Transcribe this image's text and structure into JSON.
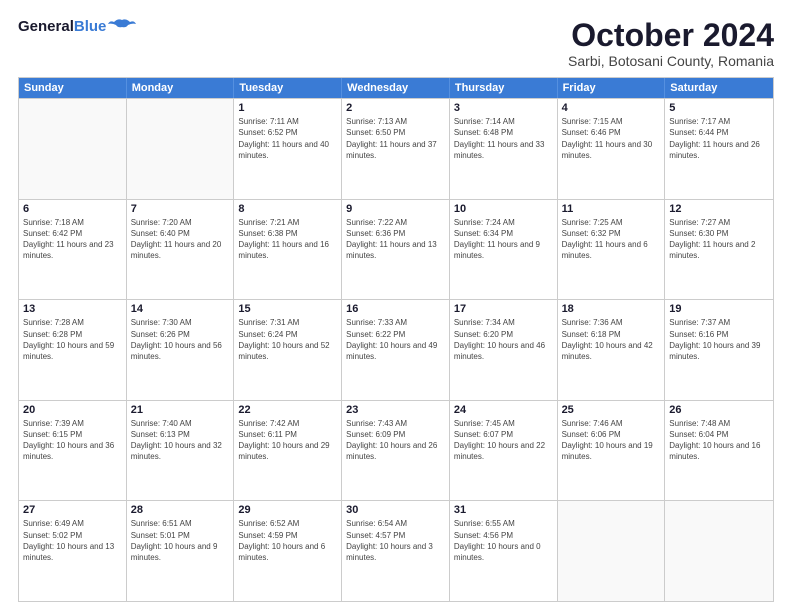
{
  "logo": {
    "line1": "General",
    "line2": "Blue"
  },
  "title": "October 2024",
  "subtitle": "Sarbi, Botosani County, Romania",
  "days": [
    "Sunday",
    "Monday",
    "Tuesday",
    "Wednesday",
    "Thursday",
    "Friday",
    "Saturday"
  ],
  "weeks": [
    [
      {
        "day": "",
        "info": ""
      },
      {
        "day": "",
        "info": ""
      },
      {
        "day": "1",
        "sunrise": "Sunrise: 7:11 AM",
        "sunset": "Sunset: 6:52 PM",
        "daylight": "Daylight: 11 hours and 40 minutes."
      },
      {
        "day": "2",
        "sunrise": "Sunrise: 7:13 AM",
        "sunset": "Sunset: 6:50 PM",
        "daylight": "Daylight: 11 hours and 37 minutes."
      },
      {
        "day": "3",
        "sunrise": "Sunrise: 7:14 AM",
        "sunset": "Sunset: 6:48 PM",
        "daylight": "Daylight: 11 hours and 33 minutes."
      },
      {
        "day": "4",
        "sunrise": "Sunrise: 7:15 AM",
        "sunset": "Sunset: 6:46 PM",
        "daylight": "Daylight: 11 hours and 30 minutes."
      },
      {
        "day": "5",
        "sunrise": "Sunrise: 7:17 AM",
        "sunset": "Sunset: 6:44 PM",
        "daylight": "Daylight: 11 hours and 26 minutes."
      }
    ],
    [
      {
        "day": "6",
        "sunrise": "Sunrise: 7:18 AM",
        "sunset": "Sunset: 6:42 PM",
        "daylight": "Daylight: 11 hours and 23 minutes."
      },
      {
        "day": "7",
        "sunrise": "Sunrise: 7:20 AM",
        "sunset": "Sunset: 6:40 PM",
        "daylight": "Daylight: 11 hours and 20 minutes."
      },
      {
        "day": "8",
        "sunrise": "Sunrise: 7:21 AM",
        "sunset": "Sunset: 6:38 PM",
        "daylight": "Daylight: 11 hours and 16 minutes."
      },
      {
        "day": "9",
        "sunrise": "Sunrise: 7:22 AM",
        "sunset": "Sunset: 6:36 PM",
        "daylight": "Daylight: 11 hours and 13 minutes."
      },
      {
        "day": "10",
        "sunrise": "Sunrise: 7:24 AM",
        "sunset": "Sunset: 6:34 PM",
        "daylight": "Daylight: 11 hours and 9 minutes."
      },
      {
        "day": "11",
        "sunrise": "Sunrise: 7:25 AM",
        "sunset": "Sunset: 6:32 PM",
        "daylight": "Daylight: 11 hours and 6 minutes."
      },
      {
        "day": "12",
        "sunrise": "Sunrise: 7:27 AM",
        "sunset": "Sunset: 6:30 PM",
        "daylight": "Daylight: 11 hours and 2 minutes."
      }
    ],
    [
      {
        "day": "13",
        "sunrise": "Sunrise: 7:28 AM",
        "sunset": "Sunset: 6:28 PM",
        "daylight": "Daylight: 10 hours and 59 minutes."
      },
      {
        "day": "14",
        "sunrise": "Sunrise: 7:30 AM",
        "sunset": "Sunset: 6:26 PM",
        "daylight": "Daylight: 10 hours and 56 minutes."
      },
      {
        "day": "15",
        "sunrise": "Sunrise: 7:31 AM",
        "sunset": "Sunset: 6:24 PM",
        "daylight": "Daylight: 10 hours and 52 minutes."
      },
      {
        "day": "16",
        "sunrise": "Sunrise: 7:33 AM",
        "sunset": "Sunset: 6:22 PM",
        "daylight": "Daylight: 10 hours and 49 minutes."
      },
      {
        "day": "17",
        "sunrise": "Sunrise: 7:34 AM",
        "sunset": "Sunset: 6:20 PM",
        "daylight": "Daylight: 10 hours and 46 minutes."
      },
      {
        "day": "18",
        "sunrise": "Sunrise: 7:36 AM",
        "sunset": "Sunset: 6:18 PM",
        "daylight": "Daylight: 10 hours and 42 minutes."
      },
      {
        "day": "19",
        "sunrise": "Sunrise: 7:37 AM",
        "sunset": "Sunset: 6:16 PM",
        "daylight": "Daylight: 10 hours and 39 minutes."
      }
    ],
    [
      {
        "day": "20",
        "sunrise": "Sunrise: 7:39 AM",
        "sunset": "Sunset: 6:15 PM",
        "daylight": "Daylight: 10 hours and 36 minutes."
      },
      {
        "day": "21",
        "sunrise": "Sunrise: 7:40 AM",
        "sunset": "Sunset: 6:13 PM",
        "daylight": "Daylight: 10 hours and 32 minutes."
      },
      {
        "day": "22",
        "sunrise": "Sunrise: 7:42 AM",
        "sunset": "Sunset: 6:11 PM",
        "daylight": "Daylight: 10 hours and 29 minutes."
      },
      {
        "day": "23",
        "sunrise": "Sunrise: 7:43 AM",
        "sunset": "Sunset: 6:09 PM",
        "daylight": "Daylight: 10 hours and 26 minutes."
      },
      {
        "day": "24",
        "sunrise": "Sunrise: 7:45 AM",
        "sunset": "Sunset: 6:07 PM",
        "daylight": "Daylight: 10 hours and 22 minutes."
      },
      {
        "day": "25",
        "sunrise": "Sunrise: 7:46 AM",
        "sunset": "Sunset: 6:06 PM",
        "daylight": "Daylight: 10 hours and 19 minutes."
      },
      {
        "day": "26",
        "sunrise": "Sunrise: 7:48 AM",
        "sunset": "Sunset: 6:04 PM",
        "daylight": "Daylight: 10 hours and 16 minutes."
      }
    ],
    [
      {
        "day": "27",
        "sunrise": "Sunrise: 6:49 AM",
        "sunset": "Sunset: 5:02 PM",
        "daylight": "Daylight: 10 hours and 13 minutes."
      },
      {
        "day": "28",
        "sunrise": "Sunrise: 6:51 AM",
        "sunset": "Sunset: 5:01 PM",
        "daylight": "Daylight: 10 hours and 9 minutes."
      },
      {
        "day": "29",
        "sunrise": "Sunrise: 6:52 AM",
        "sunset": "Sunset: 4:59 PM",
        "daylight": "Daylight: 10 hours and 6 minutes."
      },
      {
        "day": "30",
        "sunrise": "Sunrise: 6:54 AM",
        "sunset": "Sunset: 4:57 PM",
        "daylight": "Daylight: 10 hours and 3 minutes."
      },
      {
        "day": "31",
        "sunrise": "Sunrise: 6:55 AM",
        "sunset": "Sunset: 4:56 PM",
        "daylight": "Daylight: 10 hours and 0 minutes."
      },
      {
        "day": "",
        "info": ""
      },
      {
        "day": "",
        "info": ""
      }
    ]
  ]
}
